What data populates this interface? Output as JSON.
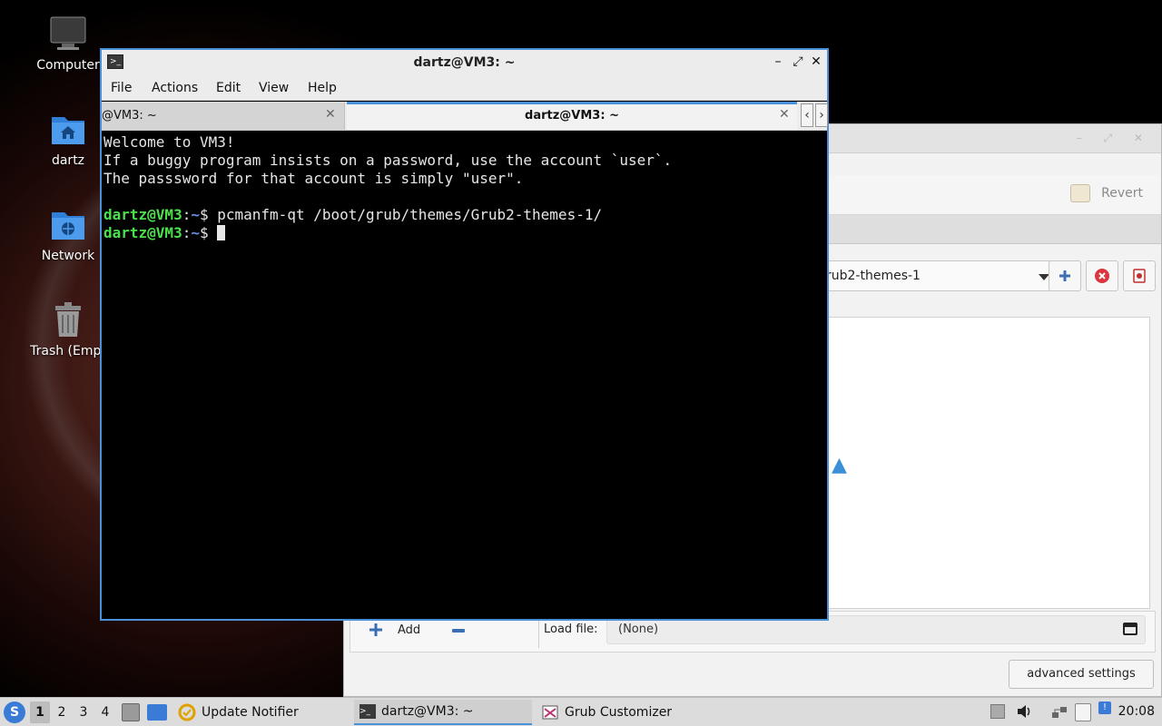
{
  "desktop": {
    "icons": [
      {
        "label": "Computer"
      },
      {
        "label": "dartz"
      },
      {
        "label": "Network"
      },
      {
        "label": "Trash (Empt"
      }
    ]
  },
  "grub_window": {
    "revert_label": "Revert",
    "theme_selected": "rub2-themes-1",
    "add_label": "Add",
    "load_file_label": "Load file:",
    "load_file_value": "(None)",
    "advanced_label": "advanced settings"
  },
  "terminal": {
    "title": "dartz@VM3: ~",
    "menu": {
      "file": "File",
      "actions": "Actions",
      "edit": "Edit",
      "view": "View",
      "help": "Help"
    },
    "tabs": [
      {
        "label": "@VM3: ~"
      },
      {
        "label": "dartz@VM3: ~"
      }
    ],
    "lines": [
      "Welcome to VM3!",
      "If a buggy program insists on a password, use the account `user`.",
      "The passsword for that account is simply \"user\"."
    ],
    "prompt_user": "dartz@VM3",
    "prompt_sep": ":",
    "prompt_path": "~",
    "prompt_symbol": "$ ",
    "command": "pcmanfm-qt /boot/grub/themes/Grub2-themes-1/"
  },
  "taskbar": {
    "workspaces": [
      "1",
      "2",
      "3",
      "4"
    ],
    "tasks": [
      {
        "label": "Update Notifier"
      },
      {
        "label": "dartz@VM3: ~"
      },
      {
        "label": "Grub Customizer"
      }
    ],
    "clock": "20:08"
  },
  "colors": {
    "accent": "#4a90d9",
    "prompt_user": "#4ce04c",
    "prompt_path": "#6b8fe6"
  }
}
